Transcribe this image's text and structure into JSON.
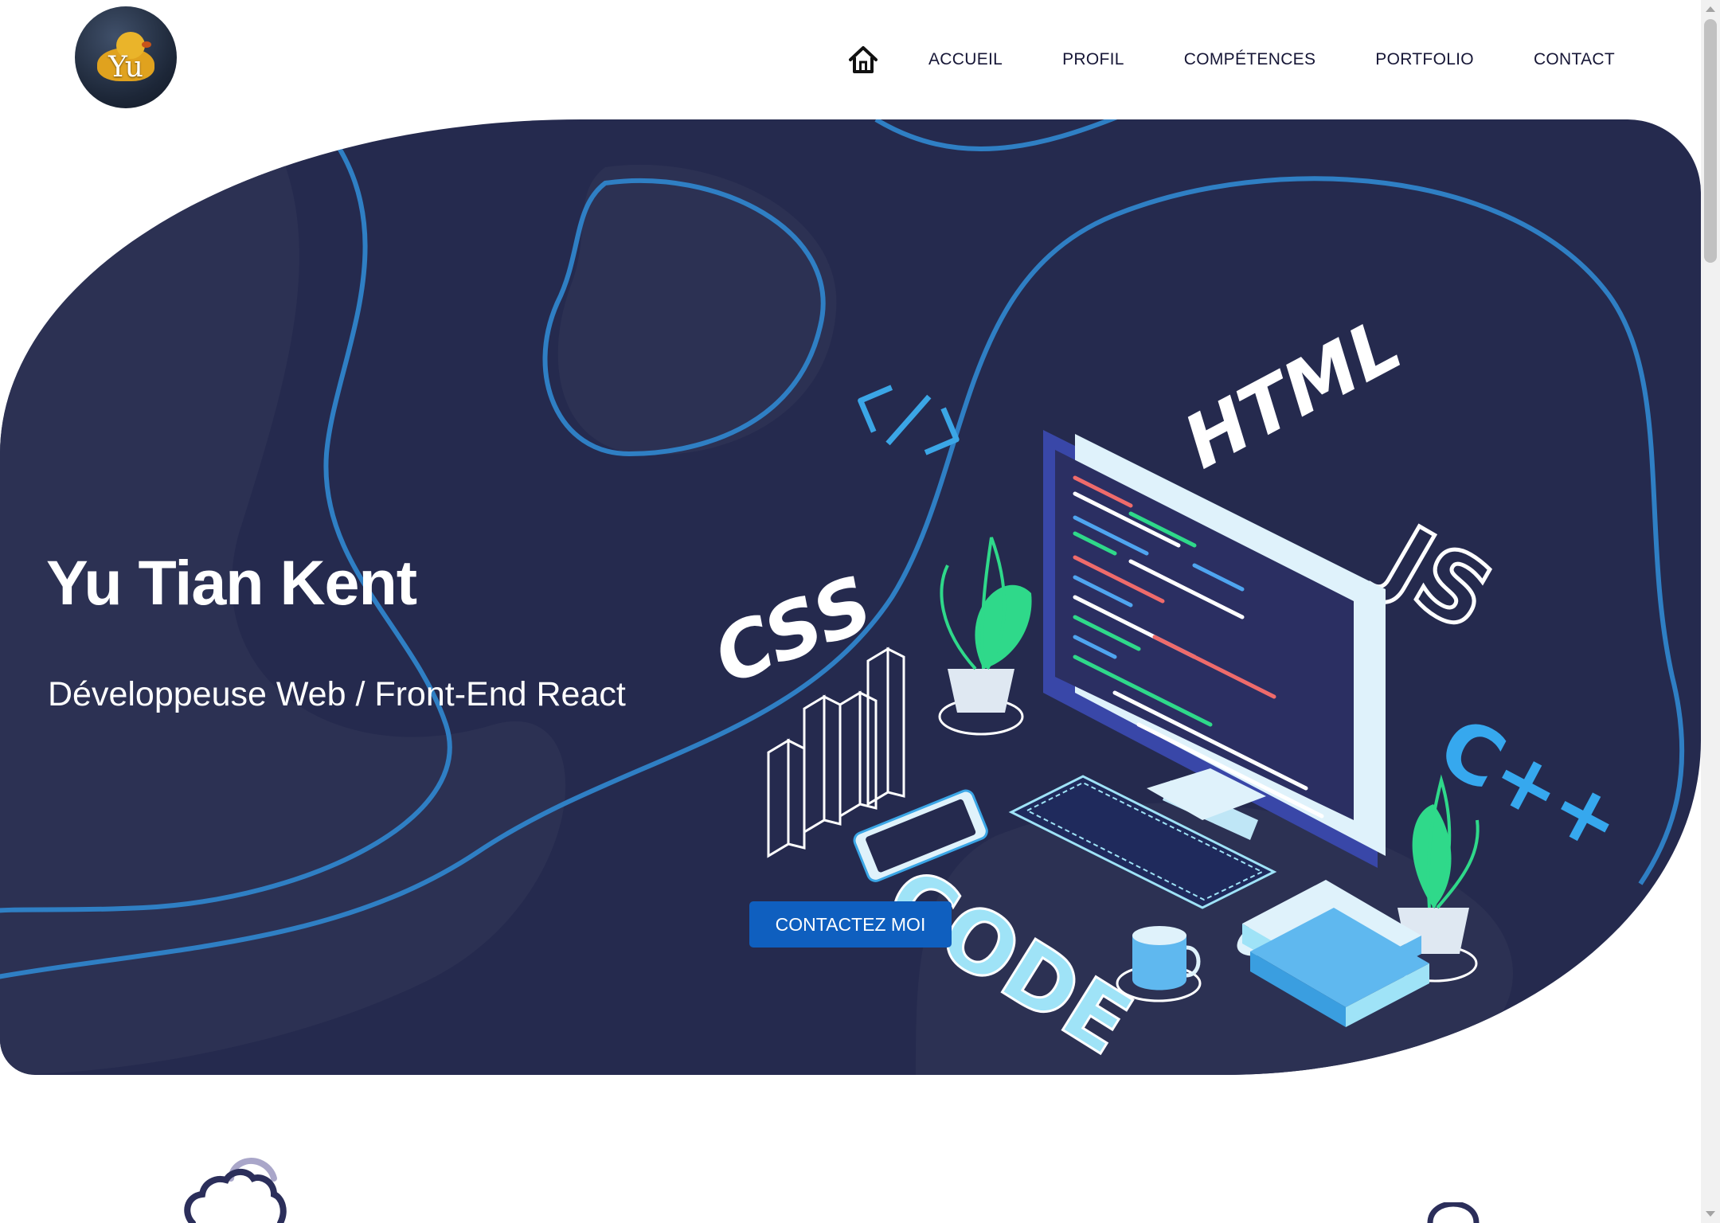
{
  "header": {
    "logo_text": "Yu",
    "nav": {
      "home_icon": "home-icon",
      "items": [
        "ACCUEIL",
        "PROFIL",
        "COMPÉTENCES",
        "PORTFOLIO",
        "CONTACT"
      ]
    }
  },
  "hero": {
    "title": "Yu Tian Kent",
    "subtitle": "Développeuse Web / Front-End React",
    "cta_label": "CONTACTEZ MOI",
    "illustration": {
      "labels": [
        "</>",
        "HTML",
        "CSS",
        "JS",
        "C++",
        "CODE"
      ]
    }
  },
  "icons": {
    "section_left": "cloud-icon",
    "section_right": "circle-icon"
  },
  "colors": {
    "hero_background": "#252a4e",
    "hero_line": "#2f7fc4",
    "accent": "#0f5fbf",
    "nav_text": "#161636",
    "green": "#2fd98a",
    "light_blue": "#9fe3f7"
  }
}
